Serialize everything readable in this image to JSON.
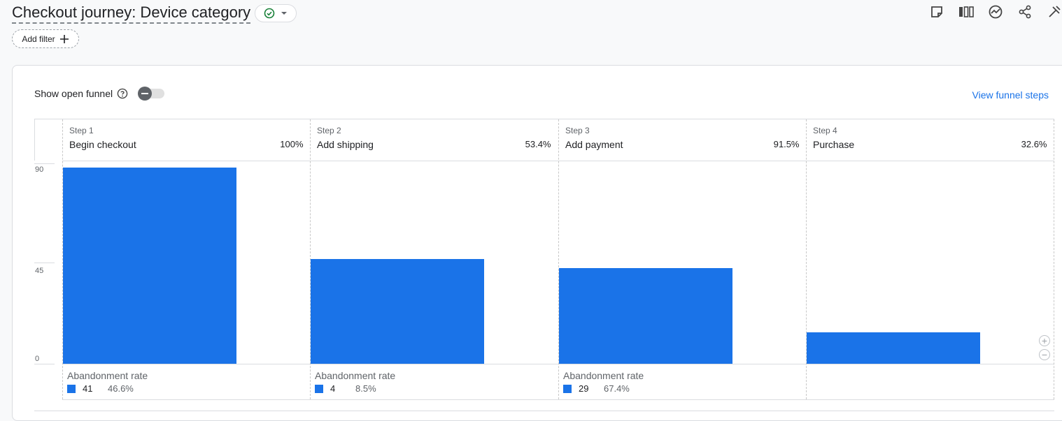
{
  "header": {
    "title": "Checkout journey: Device category",
    "add_filter_label": "Add filter",
    "tools": [
      "notes-icon",
      "compare-icon",
      "insights-icon",
      "share-icon",
      "edit-icon"
    ]
  },
  "controls": {
    "open_funnel_label": "Show open funnel",
    "view_funnel_steps": "View funnel steps"
  },
  "colors": {
    "bar": "#1a73e8",
    "link": "#1a73e8"
  },
  "chart_data": {
    "type": "bar",
    "y_ticks": [
      "90",
      "45",
      "0"
    ],
    "ylim": [
      0,
      90
    ],
    "steps": [
      {
        "step": "Step 1",
        "name": "Begin checkout",
        "percent": "100%",
        "value": 88,
        "abandonment_label": "Abandonment rate",
        "abandon_count": "41",
        "abandon_rate": "46.6%"
      },
      {
        "step": "Step 2",
        "name": "Add shipping",
        "percent": "53.4%",
        "value": 47,
        "abandonment_label": "Abandonment rate",
        "abandon_count": "4",
        "abandon_rate": "8.5%"
      },
      {
        "step": "Step 3",
        "name": "Add payment",
        "percent": "91.5%",
        "value": 43,
        "abandonment_label": "Abandonment rate",
        "abandon_count": "29",
        "abandon_rate": "67.4%"
      },
      {
        "step": "Step 4",
        "name": "Purchase",
        "percent": "32.6%",
        "value": 14
      }
    ]
  }
}
